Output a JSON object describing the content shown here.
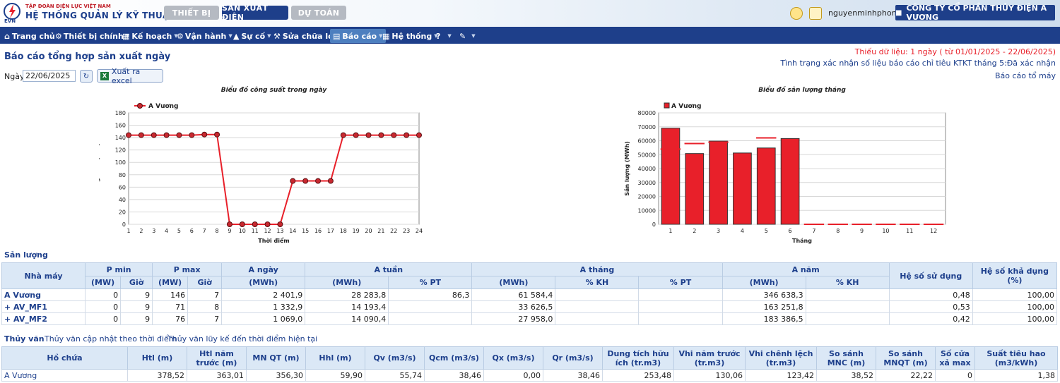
{
  "header": {
    "org_line1": "TẬP ĐOÀN ĐIỆN LỰC VIỆT NAM",
    "org_line2": "HỆ THỐNG QUẢN LÝ KỸ THUẬT",
    "logo_text": "EVN",
    "tabs": [
      {
        "label": "THIẾT BỊ",
        "active": false
      },
      {
        "label": "SẢN XUẤT ĐIỆN",
        "active": true
      },
      {
        "label": "DỰ TOÁN",
        "active": false
      }
    ],
    "username": "nguyenminhphong",
    "company": "CÔNG TY CỔ PHẦN THỦY ĐIỆN A VƯƠNG"
  },
  "nav": {
    "items": [
      {
        "label": "Trang chủ",
        "icon": "home-icon"
      },
      {
        "label": "Thiết bị chính",
        "icon": "gear-icon"
      },
      {
        "label": "Kế hoạch",
        "icon": "calendar-icon"
      },
      {
        "label": "Vận hành",
        "icon": "cogs-icon"
      },
      {
        "label": "Sự cố",
        "icon": "warning-icon"
      },
      {
        "label": "Sửa chữa lớn",
        "icon": "wrench-icon"
      },
      {
        "label": "Báo cáo",
        "icon": "chart-icon"
      },
      {
        "label": "Hệ thống",
        "icon": "grid-icon"
      },
      {
        "label": "?",
        "icon": "help-icon"
      },
      {
        "label": "",
        "icon": "tools-icon"
      }
    ]
  },
  "page": {
    "title": "Báo cáo tổng hợp sản xuất ngày",
    "missing_data": "Thiếu dữ liệu: 1 ngày ( từ 01/01/2025 - 22/06/2025)",
    "status": "Tình trạng xác nhận số liệu báo cáo chỉ tiêu KTKT tháng 5:Đã xác nhận",
    "unit_report_link": "Báo cáo tổ máy",
    "date_label": "Ngày",
    "date_value": "22/06/2025",
    "export_label": "Xuất ra excel"
  },
  "chart_data": [
    {
      "type": "line",
      "title": "Biểu đồ công suất trong ngày",
      "xlabel": "Thời điểm",
      "ylabel": "Công suất (MW)",
      "ylim": [
        0,
        180
      ],
      "yticks": [
        0,
        20,
        40,
        60,
        80,
        100,
        120,
        140,
        160,
        180
      ],
      "x": [
        1,
        2,
        3,
        4,
        5,
        6,
        7,
        8,
        9,
        10,
        11,
        12,
        13,
        14,
        15,
        16,
        17,
        18,
        19,
        20,
        21,
        22,
        23,
        24
      ],
      "series": [
        {
          "name": "A Vương",
          "color": "#e8202a",
          "values": [
            144,
            144,
            144,
            144,
            144,
            144,
            145,
            145,
            0,
            0,
            0,
            0,
            0,
            70,
            70,
            70,
            70,
            144,
            144,
            144,
            144,
            144,
            144,
            144
          ]
        }
      ],
      "grid": true,
      "legend": "top-left"
    },
    {
      "type": "bar",
      "title": "Biểu đồ sản lượng tháng",
      "xlabel": "Tháng",
      "ylabel": "Sản lượng (MWh)",
      "ylim": [
        0,
        80000
      ],
      "yticks": [
        0,
        10000,
        20000,
        30000,
        40000,
        50000,
        60000,
        70000,
        80000
      ],
      "categories": [
        "1",
        "2",
        "3",
        "4",
        "5",
        "6",
        "7",
        "8",
        "9",
        "10",
        "11",
        "12"
      ],
      "series": [
        {
          "name": "A Vương",
          "color": "#e8202a",
          "values": [
            69000,
            50800,
            59700,
            51200,
            54800,
            61584,
            0,
            0,
            0,
            0,
            0,
            0
          ]
        }
      ],
      "plan_markers": [
        54000,
        58000,
        59000,
        null,
        62000,
        null,
        0,
        0,
        0,
        0,
        0,
        0
      ],
      "grid": true,
      "legend": "top-left"
    }
  ],
  "production": {
    "section_title": "Sản lượng",
    "headers": {
      "plant": "Nhà máy",
      "pmin": "P min",
      "pmax": "P max",
      "aday": "A ngày",
      "aweek": "A tuần",
      "amonth": "A tháng",
      "ayear": "A năm",
      "usage": "Hệ số sử dụng",
      "avail": "Hệ số khả dụng (%)"
    },
    "subheaders": {
      "mw": "(MW)",
      "hour": "Giờ",
      "mwh": "(MWh)",
      "pt": "% PT",
      "kh": "% KH"
    },
    "rows": [
      {
        "name": "A Vương",
        "pmin": "0",
        "pmin_h": "9",
        "pmax": "146",
        "pmax_h": "7",
        "aday": "2 401,9",
        "aweek": "28 283,8",
        "aweek_pt": "86,3",
        "amonth": "61 584,4",
        "amonth_kh": "",
        "amonth_pt": "",
        "ayear": "346 638,3",
        "ayear_kh": "",
        "usage": "0,48",
        "avail": "100,00"
      },
      {
        "name": "+ AV_MF1",
        "pmin": "0",
        "pmin_h": "9",
        "pmax": "71",
        "pmax_h": "8",
        "aday": "1 332,9",
        "aweek": "14 193,4",
        "aweek_pt": "",
        "amonth": "33 626,5",
        "amonth_kh": "",
        "amonth_pt": "",
        "ayear": "163 251,8",
        "ayear_kh": "",
        "usage": "0,53",
        "avail": "100,00"
      },
      {
        "name": "+ AV_MF2",
        "pmin": "0",
        "pmin_h": "9",
        "pmax": "76",
        "pmax_h": "7",
        "aday": "1 069,0",
        "aweek": "14 090,4",
        "aweek_pt": "",
        "amonth": "27 958,0",
        "amonth_kh": "",
        "amonth_pt": "",
        "ayear": "183 386,5",
        "ayear_kh": "",
        "usage": "0,42",
        "avail": "100,00"
      }
    ]
  },
  "hydro": {
    "section_title": "Thủy văn",
    "link1": "Thủy văn cập nhật theo thời điểm",
    "link2": "Thủy văn lũy kế đến thời điểm hiện tại",
    "headers": [
      "Hồ chứa",
      "Htl (m)",
      "Htl năm trước (m)",
      "MN QT (m)",
      "Hhl (m)",
      "Qv (m3/s)",
      "Qcm (m3/s)",
      "Qx (m3/s)",
      "Qr (m3/s)",
      "Dung tích hữu ích (tr.m3)",
      "Vhi năm trước (tr.m3)",
      "Vhi chênh lệch (tr.m3)",
      "So sánh MNC (m)",
      "So sánh MNQT (m)",
      "Số cửa xả max",
      "Suất tiêu hao (m3/kWh)"
    ],
    "rows": [
      [
        "A Vương",
        "378,52",
        "363,01",
        "356,30",
        "59,90",
        "55,74",
        "38,46",
        "0,00",
        "38,46",
        "253,48",
        "130,06",
        "123,42",
        "38,52",
        "22,22",
        "0",
        "1,38"
      ]
    ]
  }
}
